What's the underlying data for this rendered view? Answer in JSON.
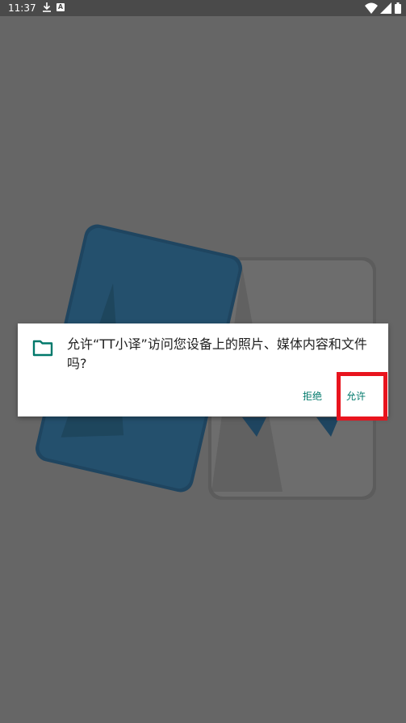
{
  "status_bar": {
    "time": "11:37",
    "a_badge": "A",
    "icons": [
      "download-icon",
      "a-badge-icon",
      "wifi-icon",
      "signal-icon",
      "battery-icon"
    ]
  },
  "dialog": {
    "message": "允许“TT小译”访问您设备上的照片、媒体内容和文件吗?",
    "deny_label": "拒绝",
    "allow_label": "允许",
    "icon": "folder-icon"
  },
  "colors": {
    "scrim": "#666666",
    "accent": "#00796b",
    "highlight": "#e8141e",
    "logo_blue": "#24506d"
  }
}
